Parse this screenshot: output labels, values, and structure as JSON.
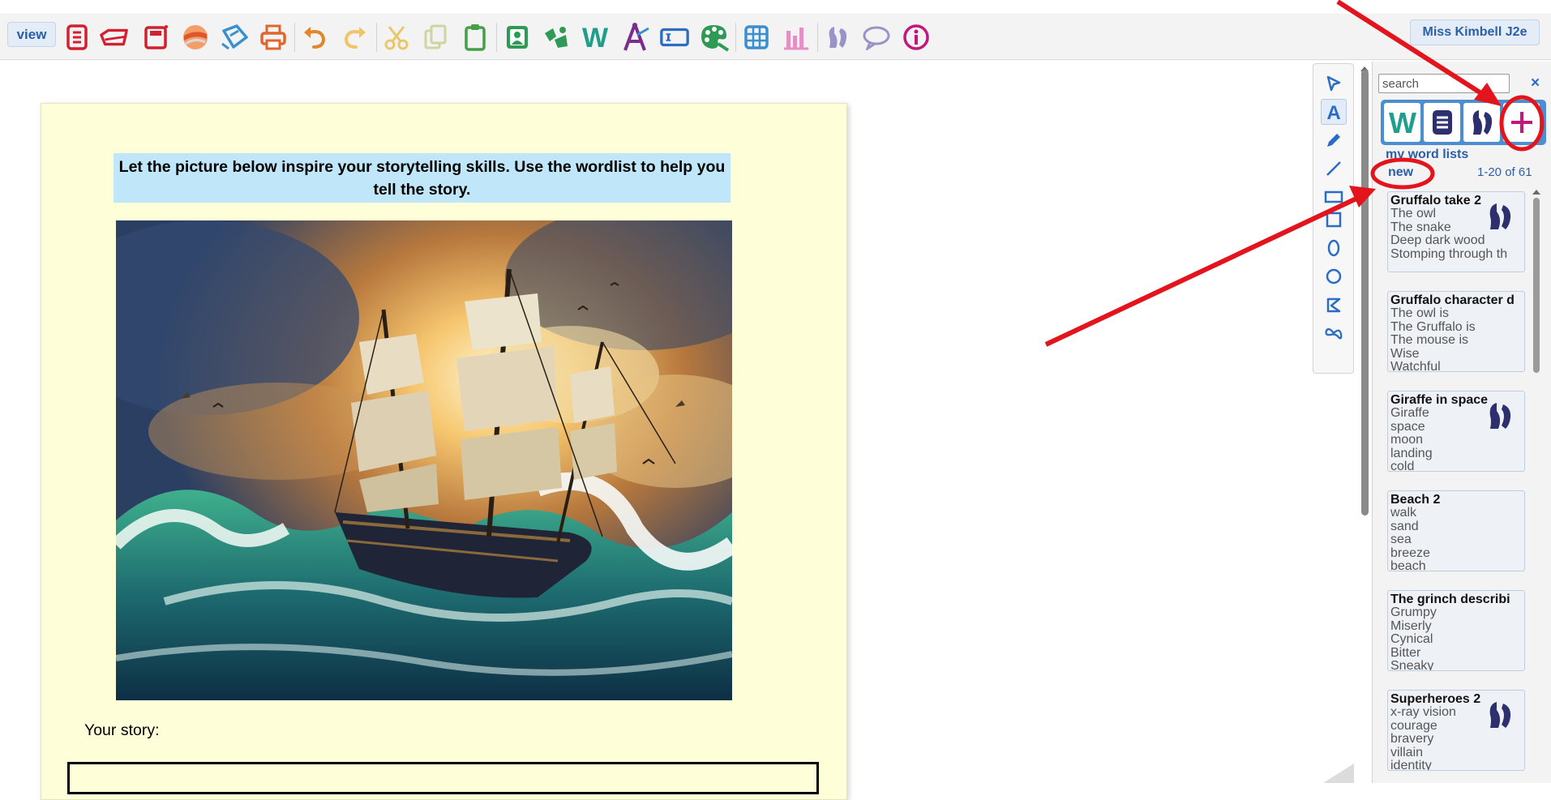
{
  "toolbar": {
    "view_label": "view",
    "icons": [
      {
        "name": "new-page-icon",
        "color": "#d2202f"
      },
      {
        "name": "open-folder-icon",
        "color": "#d2202f"
      },
      {
        "name": "save-icon",
        "color": "#d2202f"
      },
      {
        "name": "shared-gallery-icon",
        "color": "#e0662c"
      },
      {
        "name": "share-icon",
        "color": "#3a8fd0"
      },
      {
        "name": "print-icon",
        "color": "#e0662c"
      },
      {
        "name": "undo-icon",
        "color": "#e0862c"
      },
      {
        "name": "redo-icon",
        "color": "#f2c46a"
      },
      {
        "name": "cut-icon",
        "color": "#e8c86a"
      },
      {
        "name": "copy-icon",
        "color": "#cfd4a0"
      },
      {
        "name": "paste-icon",
        "color": "#43a047"
      },
      {
        "name": "insert-image-icon",
        "color": "#2e9a55"
      },
      {
        "name": "clipart-icon",
        "color": "#2e9a55"
      },
      {
        "name": "wordart-icon",
        "color": "#1f9e8c"
      },
      {
        "name": "drawing-tool-icon",
        "color": "#7b2d8e"
      },
      {
        "name": "textbox-icon",
        "color": "#2b6cc4"
      },
      {
        "name": "paint-palette-icon",
        "color": "#2e9a55"
      },
      {
        "name": "table-icon",
        "color": "#3a8fd0"
      },
      {
        "name": "chart-icon",
        "color": "#e58fc5"
      },
      {
        "name": "speech-audio-icon",
        "color": "#9a93c8"
      },
      {
        "name": "speech-bubble-icon",
        "color": "#9a93c8"
      },
      {
        "name": "info-icon",
        "color": "#c2187e"
      }
    ],
    "user_label": "Miss Kimbell J2e"
  },
  "document": {
    "instruction": "Let the picture below inspire your storytelling skills.  Use the wordlist to help you tell the story.",
    "image_alt": "sailing ship on stormy sea",
    "story_label": "Your story:"
  },
  "tools": [
    {
      "name": "select-tool-icon"
    },
    {
      "name": "text-tool-icon"
    },
    {
      "name": "pencil-tool-icon"
    },
    {
      "name": "line-tool-icon"
    },
    {
      "name": "rectangle-tool-icon"
    },
    {
      "name": "square-tool-icon"
    },
    {
      "name": "ellipse-tool-icon"
    },
    {
      "name": "circle-tool-icon"
    },
    {
      "name": "polygon-tool-icon"
    },
    {
      "name": "freehand-tool-icon"
    }
  ],
  "sidebar": {
    "search_placeholder": "search",
    "close_symbol": "×",
    "section_title": "my word lists",
    "new_label": "new",
    "paging": "1-20 of 61",
    "lists": [
      {
        "title": "Gruffalo take 2",
        "words": [
          "The owl",
          "The snake",
          "Deep dark wood",
          "Stomping through th"
        ]
      },
      {
        "title": "Gruffalo character d",
        "words": [
          "The owl is",
          "The Gruffalo is",
          "The mouse is",
          "Wise",
          "Watchful"
        ]
      },
      {
        "title": "Giraffe in space",
        "words": [
          "Giraffe",
          "space",
          "moon",
          "landing",
          "cold"
        ]
      },
      {
        "title": "Beach 2",
        "words": [
          "walk",
          "sand",
          "sea",
          "breeze",
          "beach"
        ]
      },
      {
        "title": "The grinch describi",
        "words": [
          "Grumpy",
          "Miserly",
          "Cynical",
          "Bitter",
          "Sneaky"
        ]
      },
      {
        "title": "Superheroes 2",
        "words": [
          "x-ray vision",
          "courage",
          "bravery",
          "villain",
          "identity"
        ]
      }
    ]
  },
  "annotation_color": "#e3141b"
}
